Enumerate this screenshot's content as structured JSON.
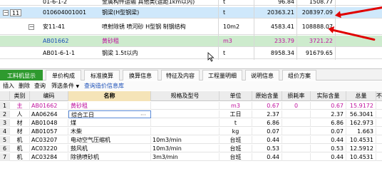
{
  "top_rows": [
    {
      "code": "01-6-1-2",
      "name": "金属构件运输 其他类(运距1km以内)",
      "unit": "t",
      "a": "96.84",
      "b": "1508.77"
    },
    {
      "idx": "11",
      "code": "010604001001",
      "name": "钢梁(H型钢梁)",
      "unit": "t",
      "a": "20363.21",
      "b": "208397.09"
    },
    {
      "code": "安11-41",
      "name": "喷射除锈 喷河砂 H型钢 制钢结构",
      "unit": "10m2",
      "a": "4583.41",
      "b": "108888.07"
    },
    {
      "code": "AB01662",
      "name": "黄砂租",
      "unit": "m3",
      "a": "233.79",
      "b": "3721.22"
    },
    {
      "code": "AB01-6-1-1",
      "name": "钢梁 1.5t以内",
      "unit": "t",
      "a": "8958.34",
      "b": "91679.65"
    }
  ],
  "tabs": [
    "工料机显示",
    "单价构成",
    "标准换算",
    "换算信息",
    "特征及内容",
    "工程量明细",
    "说明信息",
    "组价方案"
  ],
  "toolbar": {
    "insert": "插入",
    "delete": "删除",
    "query": "查询",
    "filter": "筛选条件",
    "filter_arrow": "▼",
    "price_query": "查询造价信息库"
  },
  "grid_headers": [
    "类别",
    "编码",
    "名称",
    "规格及型号",
    "单位",
    "原始含量",
    "损耗率",
    "实际含量",
    "总量",
    "不"
  ],
  "grid_rows": [
    {
      "n": "1",
      "cat": "主",
      "code": "AB01662",
      "name": "黄砂租",
      "spec": "",
      "unit": "m3",
      "orig": "0.67",
      "loss": "0",
      "actual": "0.67",
      "total": "15.9172",
      "style": "magenta"
    },
    {
      "n": "2",
      "cat": "人",
      "code": "AA06264",
      "name": "综合工日",
      "spec": "",
      "unit": "工日",
      "orig": "2.37",
      "loss": "",
      "actual": "2.37",
      "total": "56.3041",
      "style": ""
    },
    {
      "n": "3",
      "cat": "材",
      "code": "AB01048",
      "name": "煤",
      "spec": "",
      "unit": "t",
      "orig": "6.86",
      "loss": "",
      "actual": "6.86",
      "total": "162.973",
      "style": ""
    },
    {
      "n": "4",
      "cat": "材",
      "code": "AB01057",
      "name": "木柴",
      "spec": "",
      "unit": "kg",
      "orig": "0.07",
      "loss": "",
      "actual": "0.07",
      "total": "1.663",
      "style": ""
    },
    {
      "n": "5",
      "cat": "机",
      "code": "AC03207",
      "name": "电动空气压缩机",
      "spec": "10m3/min",
      "unit": "台班",
      "orig": "0.44",
      "loss": "",
      "actual": "0.44",
      "total": "10.4531",
      "style": ""
    },
    {
      "n": "6",
      "cat": "机",
      "code": "AC03220",
      "name": "鼓风机",
      "spec": "10m3/min",
      "unit": "台班",
      "orig": "0.53",
      "loss": "",
      "actual": "0.53",
      "total": "12.5912",
      "style": ""
    },
    {
      "n": "7",
      "cat": "机",
      "code": "AC03284",
      "name": "除锈喷砂机",
      "spec": "3m3/min",
      "unit": "台班",
      "orig": "0.44",
      "loss": "",
      "actual": "0.44",
      "total": "10.4531",
      "style": ""
    }
  ],
  "ellipsis": "···",
  "colors": {
    "tab_active": "#2e9a2e",
    "selection": "#cfe8fb",
    "highlight_green": "#cdebcd",
    "annotation": "#e00000"
  }
}
